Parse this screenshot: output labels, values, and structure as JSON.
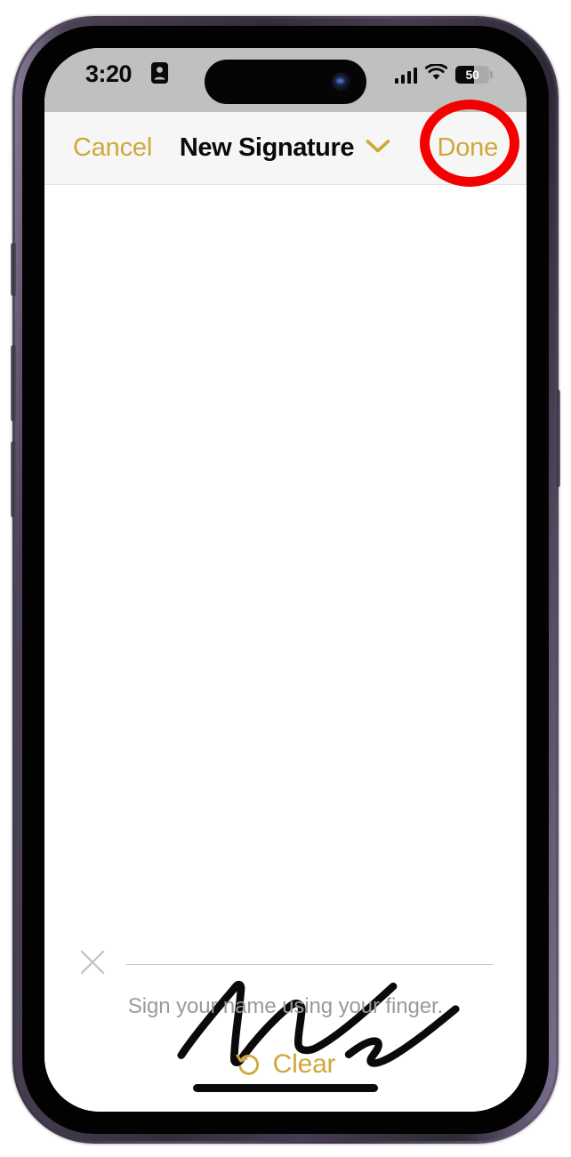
{
  "device": {
    "model_frame": "iphone-pro",
    "frame_color": "#4a4152",
    "bezel_color": "#020203"
  },
  "status_bar": {
    "time": "3:20",
    "background_color": "#bfc1be",
    "focus_icon": "id-card-icon",
    "cellular_icon": "cellular-bars-icon",
    "cellular_bars": 4,
    "wifi_icon": "wifi-icon",
    "battery_icon": "battery-icon",
    "battery_level": "50",
    "battery_fill_percent": 56
  },
  "nav_bar": {
    "cancel_label": "Cancel",
    "title": "New Signature",
    "title_chevron_icon": "chevron-down-icon",
    "done_label": "Done",
    "accent_color": "#cfa73a",
    "background_color": "#f6f6f6"
  },
  "annotation": {
    "type": "red-circle-highlight",
    "target": "done-button",
    "color": "#f50000"
  },
  "signature_pad": {
    "x_mark_icon": "x-mark-icon",
    "baseline_color": "#c8c8c8",
    "hint_text": "Sign your name using your finger.",
    "hint_color": "#9a9a9a",
    "ink_color": "#0a0a0a",
    "has_signature": true,
    "strokes": [
      "M 160 1035 C 175 1012, 200 982, 224 953 C 226 950, 230 950, 230 955 C 228 985, 222 1015, 222 1040 C 222 1044, 226 1045, 229 1041 C 245 1018, 268 992, 288 976 C 294 971, 301 973, 301 981 C 300 996, 296 1012, 297 1022 C 298 1030, 308 1031, 318 1026 C 345 1012, 382 977, 408 953",
      "M 356 1034 C 366 1026, 378 1018, 386 1018 C 392 1018, 392 1024, 388 1030 C 384 1036, 380 1040, 382 1043 C 385 1047, 398 1042, 412 1033 C 437 1017, 464 994, 481 980"
    ]
  },
  "clear_button": {
    "icon": "undo-arrow-icon",
    "label": "Clear",
    "color": "#cfa73a"
  },
  "home_indicator": {
    "color": "#0a0a0a"
  }
}
